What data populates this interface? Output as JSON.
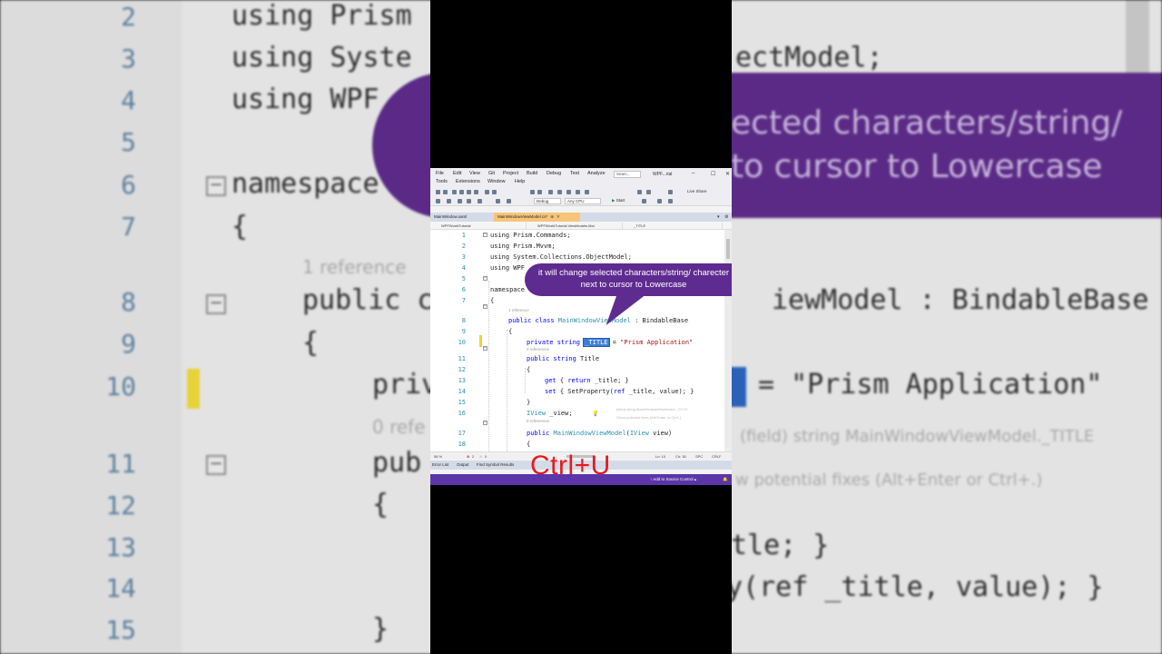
{
  "background": {
    "line_numbers": [
      "2",
      "3",
      "4",
      "5",
      "6",
      "7",
      "8",
      "9",
      "10",
      "11",
      "12",
      "13",
      "14",
      "15"
    ],
    "lines": {
      "l2": "using Prism",
      "l3a": "using Syste",
      "l3b": "ectModel;",
      "l4": "using WPF",
      "l6": "namespace",
      "l7": "{",
      "ref1": "1 reference",
      "l8a": "public c",
      "l8b": "iewModel : BindableBase",
      "l9": "{",
      "l10a": "priv",
      "l10b": "= \"Prism Application\"",
      "ref0": "0 refe",
      "l11": "pub",
      "l12": "{",
      "l13": "tle; }",
      "l14": "y(ref _title, value); }",
      "l15": "}",
      "tip1": "(field) string MainWindowViewModel._TITLE",
      "tip2": "w potential fixes (Alt+Enter or Ctrl+.)"
    },
    "bubble_text": "ected characters/string/\nto cursor to Lowercase"
  },
  "ide": {
    "menu": [
      "File",
      "Edit",
      "View",
      "Git",
      "Project",
      "Build",
      "Debug",
      "Test",
      "Analyze",
      "Tools",
      "Extensions",
      "Window",
      "Help"
    ],
    "search_placeholder": "Searc...",
    "window_title": "WPF...rial",
    "live_share": "Live Share",
    "config": "Debug",
    "platform": "Any CPU",
    "start": "Start",
    "tabs": {
      "tab1": "MainWindow.xaml",
      "tab2": "MainWindowViewModel.cs*"
    },
    "nav": {
      "project": "WPFWorldTutorial",
      "class": "WPFWorldTutorial.ViewModels.Mai",
      "member": "_TITLE"
    },
    "code": {
      "l1": "using Prism.Commands;",
      "l2": "using Prism.Mvvm;",
      "l3": "using System.Collections.ObjectModel;",
      "l4": "using WPF",
      "l6": "namespace",
      "l7": "{",
      "ref8": "1 reference",
      "l8_kw": "public class ",
      "l8_type": "MainWindowViewModel",
      "l8_rest": " : BindableBase",
      "l9": "{",
      "l10_kw": "private string ",
      "l10_sel": "_TITLE",
      "l10_eq": " = ",
      "l10_str": "\"Prism Application\"",
      "ref11": "0 references",
      "l11_kw": "public string ",
      "l11_name": "Title",
      "l12": "{",
      "l13_kw": "get",
      "l13_rest": " { ",
      "l13_ret": "return",
      "l13_end": " _title; }",
      "l14_kw": "set",
      "l14_rest": " { SetProperty(",
      "l14_ref": "ref",
      "l14_end": " _title, value); }",
      "l15": "}",
      "l16_type": "IView",
      "l16_rest": " _view;",
      "ref17": "0 references",
      "l17_kw": "public ",
      "l17_type": "MainWindowViewModel",
      "l17_open": "(",
      "l17_ptype": "IView",
      "l17_rest": " view)",
      "l18": "{"
    },
    "line_numbers": [
      "1",
      "2",
      "3",
      "4",
      "5",
      "6",
      "7",
      "8",
      "9",
      "10",
      "11",
      "12",
      "13",
      "14",
      "15",
      "16",
      "17",
      "18"
    ],
    "quick_info": {
      "line1": "(field) string MainWindowViewModel._TITLE",
      "line2": "Show potential fixes (Alt+Enter or Ctrl+.)"
    },
    "status": {
      "zoom": "58 %",
      "errors": "2",
      "warnings": "0",
      "position": "Ln: 10",
      "column": "Ch: 30",
      "spc": "SPC",
      "crlf": "CRLF"
    },
    "bottom_tabs": [
      "Error List",
      "Output",
      "Find Symbol Results"
    ],
    "source_control": "Add to Source Control"
  },
  "callout": {
    "text": "it will change selected characters/string/ charecter next to cursor to Lowercase"
  },
  "shortcut": "Ctrl+U",
  "colors": {
    "accent_purple": "#5e2b91",
    "status_purple": "#5a36a8",
    "shortcut_red": "#e8181e",
    "selection_blue": "#3d7fd6"
  }
}
